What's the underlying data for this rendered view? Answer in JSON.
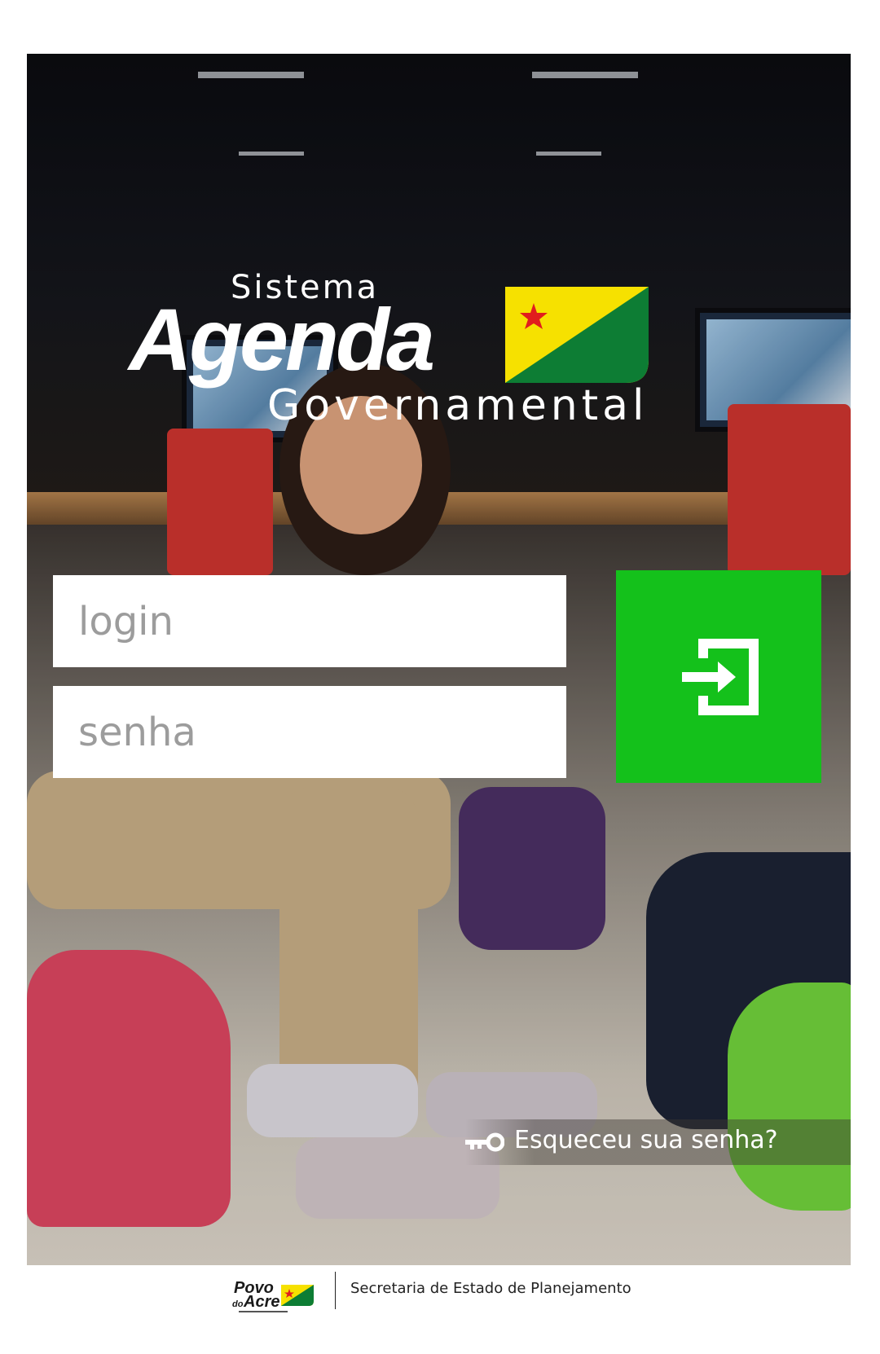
{
  "brand": {
    "line1": "Sistema",
    "line2": "Agenda",
    "line3": "Governamental",
    "flag_colors": {
      "yellow": "#f6e100",
      "green": "#0d7d34",
      "star": "#e11d1d"
    }
  },
  "form": {
    "login_placeholder": "login",
    "password_placeholder": "senha",
    "submit_icon": "login-icon",
    "submit_color": "#14c11b"
  },
  "forgot": {
    "label": "Esqueceu sua senha?",
    "icon": "key-icon"
  },
  "footer": {
    "logo_line1": "Povo",
    "logo_line2": "Acre",
    "logo_small": "do",
    "org": "Secretaria de Estado de Planejamento"
  }
}
